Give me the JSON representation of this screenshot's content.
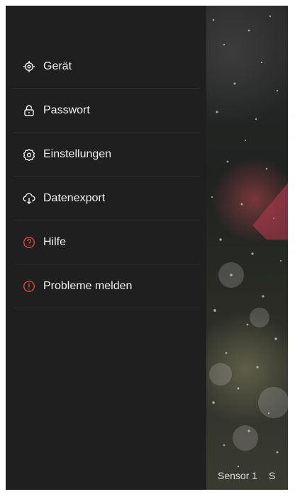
{
  "drawer": {
    "items": [
      {
        "label": "Gerät",
        "icon": "target-icon"
      },
      {
        "label": "Passwort",
        "icon": "lock-icon"
      },
      {
        "label": "Einstellungen",
        "icon": "gear-icon"
      },
      {
        "label": "Datenexport",
        "icon": "cloud-download-icon"
      },
      {
        "label": "Hilfe",
        "icon": "help-circle-icon"
      },
      {
        "label": "Probleme melden",
        "icon": "alert-circle-icon"
      }
    ]
  },
  "background": {
    "tabs": [
      {
        "label": "Sensor 1"
      },
      {
        "label": "S"
      }
    ]
  },
  "colors": {
    "drawer_bg": "#1f1f1f",
    "text": "#f2f2f2",
    "divider": "#2e2e2e",
    "accent_red": "#e0473a"
  }
}
